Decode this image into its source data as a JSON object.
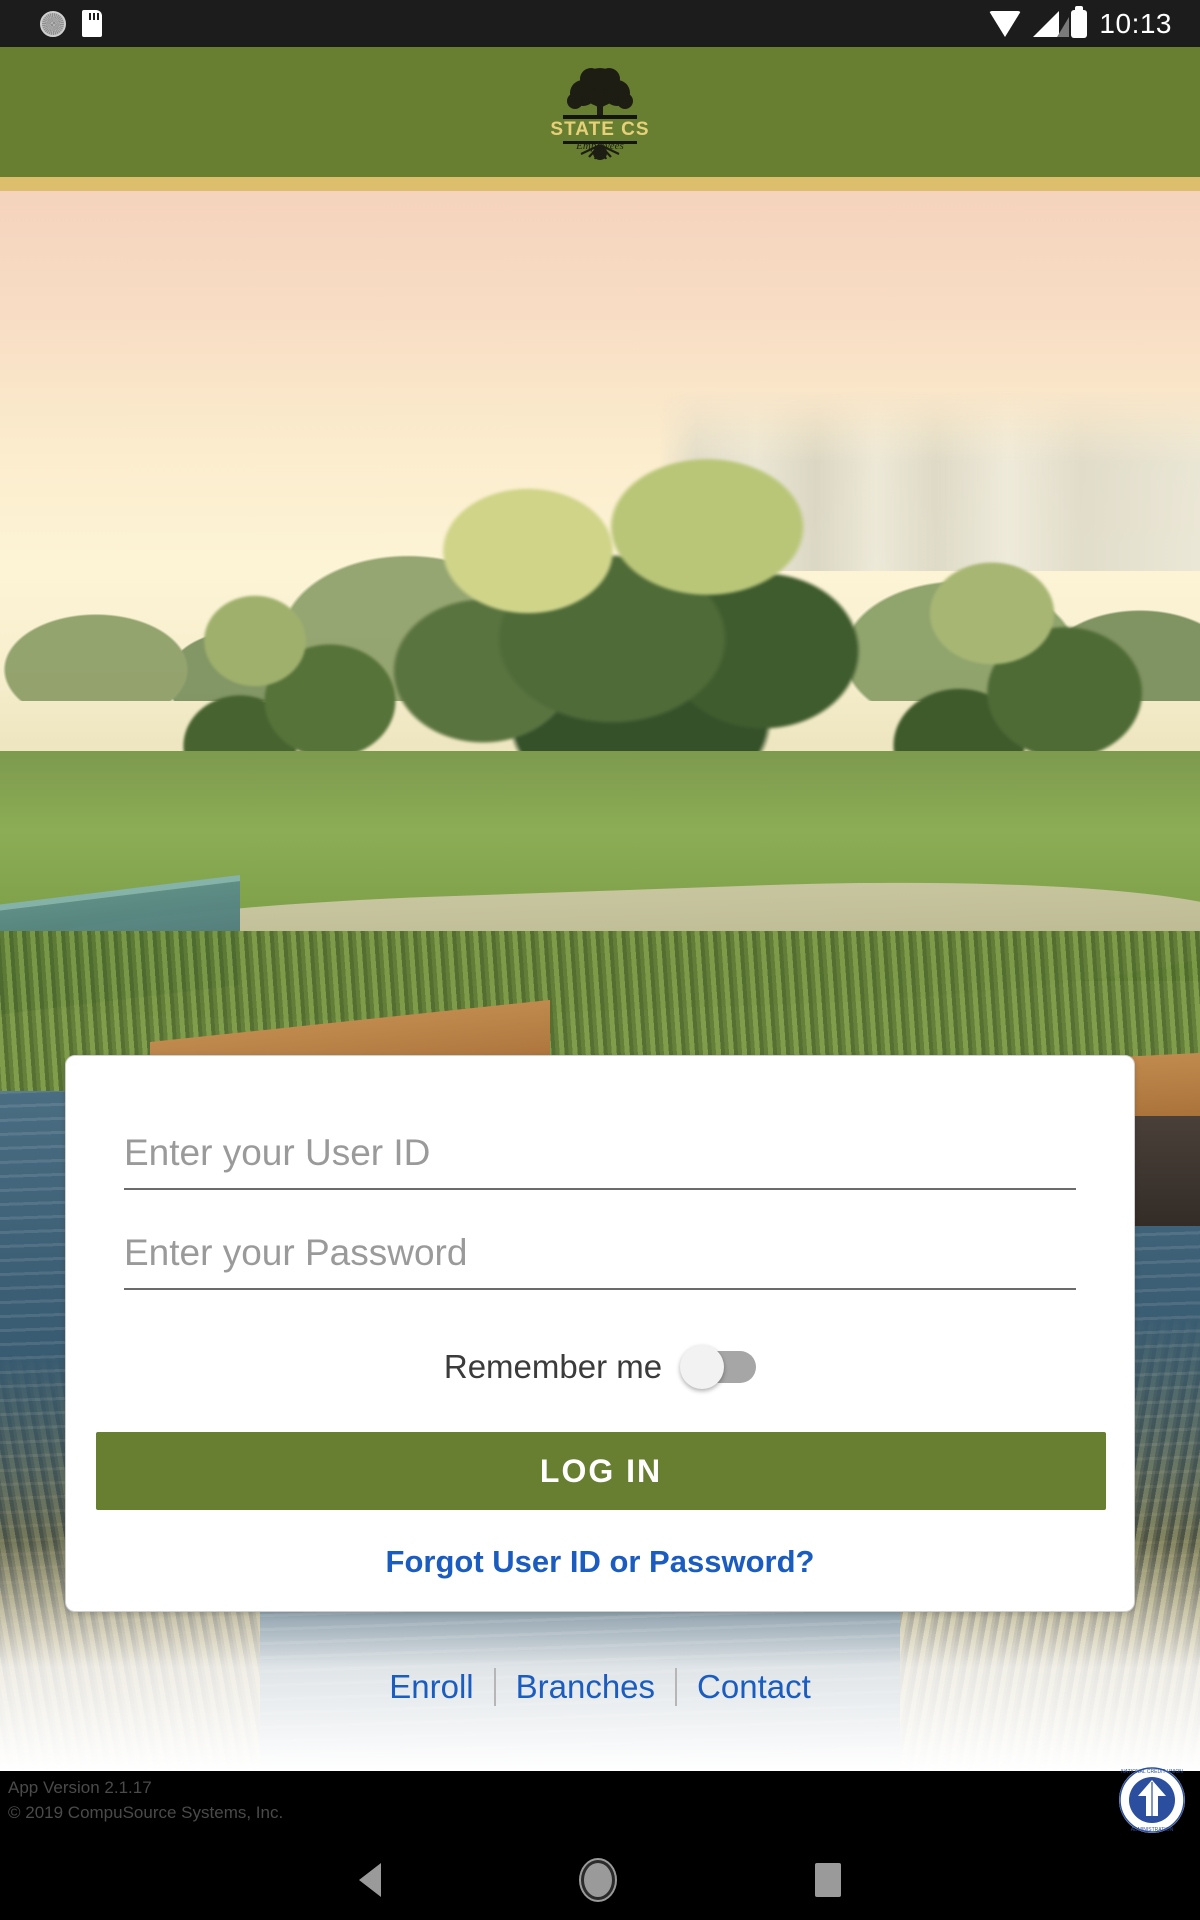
{
  "status_bar": {
    "time": "10:13",
    "icons": [
      "sync-icon",
      "sd-card-icon",
      "wifi-icon",
      "cellular-signal-icon",
      "battery-icon"
    ]
  },
  "header": {
    "brand_name": "STATE CS",
    "brand_sub": "Employees",
    "brand_tag": "Federal Credit Union",
    "background_color": "#687f31",
    "accent_stripe_color": "#ddbe6c",
    "logo_icon": "tree-logo-icon"
  },
  "login": {
    "userid": {
      "value": "",
      "placeholder": "Enter your User ID"
    },
    "password": {
      "value": "",
      "placeholder": "Enter your Password"
    },
    "remember_label": "Remember me",
    "remember_checked": false,
    "login_label": "LOG IN",
    "forgot_label": "Forgot User ID or Password?",
    "button_color": "#687f31",
    "link_color": "#1b5cc0"
  },
  "footer": {
    "links": [
      {
        "label": "Enroll"
      },
      {
        "label": "Branches"
      },
      {
        "label": "Contact"
      }
    ],
    "app_version": "App Version 2.1.17",
    "copyright": "© 2019 CompuSource Systems, Inc.",
    "badge_icon": "ncua-logo-icon",
    "badge_text": "NATIONAL CREDIT UNION ADMINISTRATION"
  },
  "nav_bar": {
    "back": "back-icon",
    "home": "home-icon",
    "recents": "recents-icon"
  }
}
